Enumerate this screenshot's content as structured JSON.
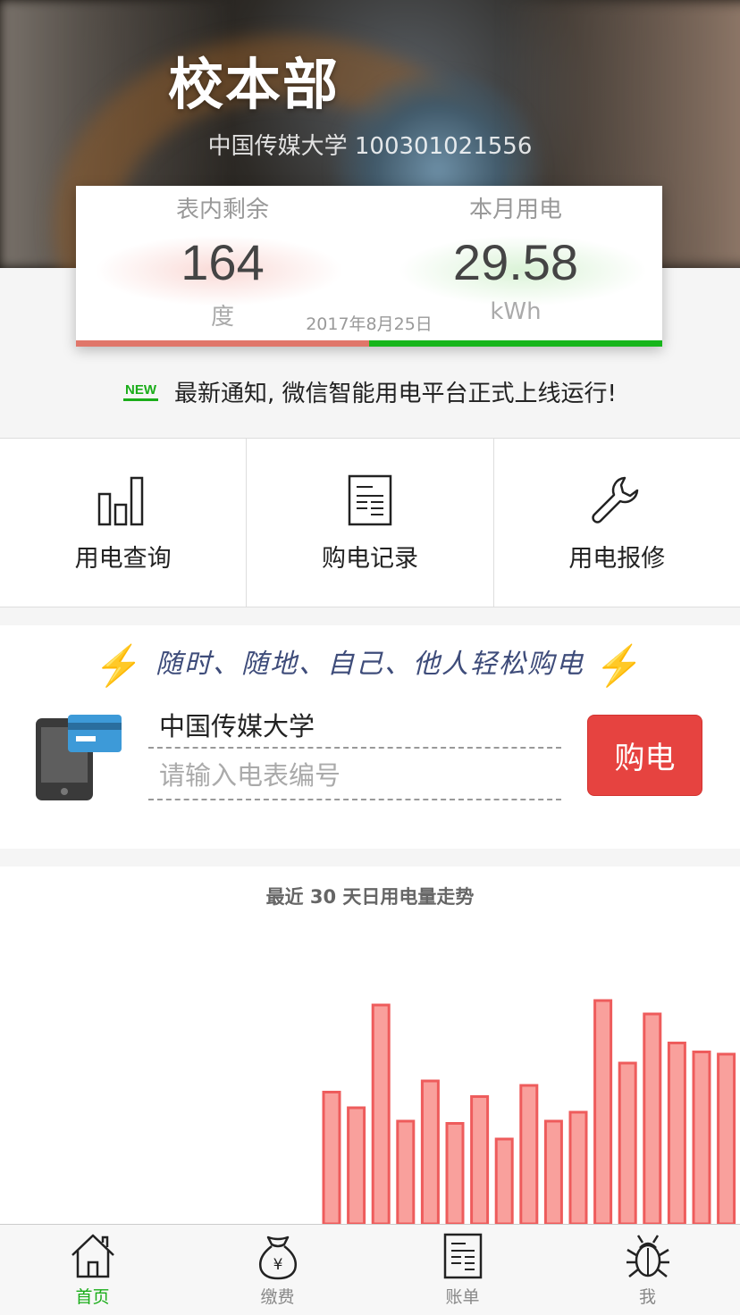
{
  "header": {
    "campus_title": "校本部",
    "school_name": "中国传媒大学",
    "account_number": "100301021556"
  },
  "stats": {
    "remaining_label": "表内剩余",
    "remaining_value": "164",
    "remaining_unit": "度",
    "month_usage_label": "本月用电",
    "month_usage_value": "29.58",
    "month_usage_unit": "kWh",
    "date": "2017年8月25日",
    "colors": {
      "left_bar": "#e0766a",
      "right_bar": "#16b51a"
    }
  },
  "notice": {
    "badge": "NEW",
    "text": "最新通知, 微信智能用电平台正式上线运行!"
  },
  "menu": {
    "items": [
      {
        "label": "用电查询",
        "icon": "bar-chart-icon"
      },
      {
        "label": "购电记录",
        "icon": "receipt-icon"
      },
      {
        "label": "用电报修",
        "icon": "wrench-icon"
      }
    ]
  },
  "purchase": {
    "slogan": "随时、随地、自己、他人轻松购电",
    "school_name": "中国传媒大学",
    "meter_placeholder": "请输入电表编号",
    "meter_value": "",
    "buy_label": "购电"
  },
  "chart_data": {
    "type": "bar",
    "title": "最近 30 天日用电量走势",
    "values": [
      0,
      0,
      0,
      0,
      0,
      0,
      0,
      0,
      0,
      0,
      0,
      0,
      0,
      5.9,
      5.2,
      9.8,
      4.6,
      6.4,
      4.5,
      5.7,
      3.8,
      6.2,
      4.6,
      5.0,
      10.0,
      7.2,
      9.4,
      8.1,
      7.7,
      7.6
    ],
    "bar_color": "#f9a09c",
    "bar_stroke": "#ee5c5c"
  },
  "tabbar": {
    "items": [
      {
        "label": "首页",
        "icon": "home-icon",
        "active": true
      },
      {
        "label": "缴费",
        "icon": "money-bag-icon",
        "active": false
      },
      {
        "label": "账单",
        "icon": "bill-icon",
        "active": false
      },
      {
        "label": "我",
        "icon": "bug-icon",
        "active": false
      }
    ]
  }
}
